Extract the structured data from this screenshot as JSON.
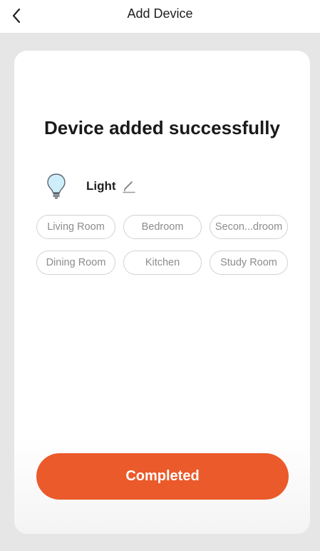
{
  "header": {
    "title": "Add Device",
    "back_icon": "chevron-left-icon"
  },
  "card": {
    "title": "Device added successfully",
    "device": {
      "icon": "light-bulb-icon",
      "name": "Light",
      "edit_icon": "pencil-icon"
    },
    "rooms": [
      {
        "label": "Living Room"
      },
      {
        "label": "Bedroom"
      },
      {
        "label": "Secon...droom"
      },
      {
        "label": "Dining Room"
      },
      {
        "label": "Kitchen"
      },
      {
        "label": "Study Room"
      }
    ],
    "completed_label": "Completed"
  },
  "colors": {
    "accent": "#eb5a2a",
    "background": "#e6e6e6",
    "chip_border": "#d2d2d2",
    "chip_text": "#8c8c8c"
  }
}
